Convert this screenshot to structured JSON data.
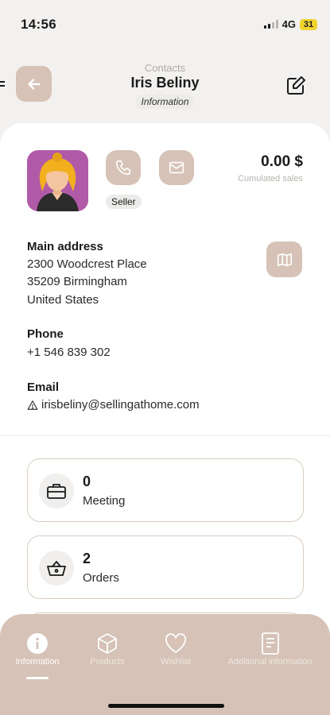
{
  "status_bar": {
    "time": "14:56",
    "network": "4G",
    "battery": "31"
  },
  "header": {
    "breadcrumb": "Contacts",
    "contact_name": "Iris Beliny",
    "section": "Information"
  },
  "profile": {
    "role_badge": "Seller",
    "cumulated_sales_value": "0.00 $",
    "cumulated_sales_label": "Cumulated sales"
  },
  "address": {
    "label": "Main address",
    "line1": "2300 Woodcrest Place",
    "line2": "35209 Birmingham",
    "line3": "United States"
  },
  "phone": {
    "label": "Phone",
    "value": "+1 546 839 302"
  },
  "email": {
    "label": "Email",
    "value": "irisbeliny@sellingathome.com"
  },
  "stats": [
    {
      "value": "0",
      "label": "Meeting",
      "icon": "briefcase-icon"
    },
    {
      "value": "2",
      "label": "Orders",
      "icon": "basket-icon"
    }
  ],
  "bottom_nav": [
    {
      "label": "Information",
      "icon": "info-icon",
      "active": true
    },
    {
      "label": "Products",
      "icon": "cube-icon",
      "active": false
    },
    {
      "label": "Wishlist",
      "icon": "heart-icon",
      "active": false
    },
    {
      "label": "Additional information",
      "icon": "document-icon",
      "active": false
    }
  ],
  "colors": {
    "accent": "#d6c2b6",
    "avatar_bg": "#b05aa8",
    "background": "#f3f1ef"
  }
}
